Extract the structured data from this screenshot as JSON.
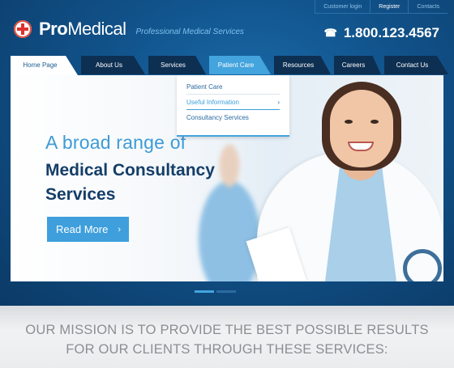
{
  "toplinks": [
    "Customer login",
    "Register",
    "Contacts"
  ],
  "logo": {
    "pro": "Pro",
    "medical": "Medical",
    "tagline": "Professional Medical Services"
  },
  "phone": {
    "number": "1.800.123.4567",
    "icon": "phone-icon"
  },
  "nav": {
    "items": [
      "Home Page",
      "About Us",
      "Services",
      "Patient Care",
      "Resources",
      "Careers",
      "Contact Us"
    ],
    "active": "Home Page",
    "open": "Patient Care"
  },
  "dropdown": {
    "items": [
      "Patient Care",
      "Useful Information",
      "Consultancy Services"
    ],
    "highlighted": "Useful Information"
  },
  "banner": {
    "headline1": "A broad range of",
    "headline2": "Medical Consultancy Services",
    "button": "Read More"
  },
  "slider": {
    "slides": 2,
    "active": 1
  },
  "mission": {
    "line1": "OUR MISSION IS TO PROVIDE THE BEST POSSIBLE RESULTS",
    "line2": "FOR OUR CLIENTS THROUGH THESE SERVICES:"
  },
  "colors": {
    "accent": "#43a4de",
    "brand_blue": "#11528a",
    "dark_tab": "#0d2f52",
    "cross": "#e0322f"
  }
}
